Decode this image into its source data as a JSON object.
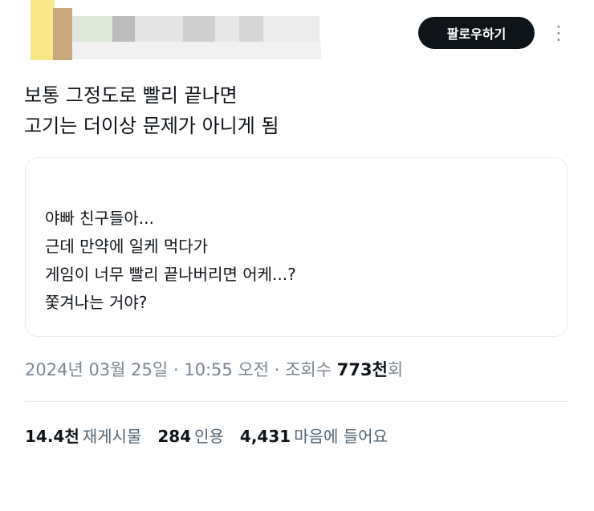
{
  "header": {
    "follow_label": "팔로우하기",
    "more_icon": "⋮",
    "more_icon_name": "more-vertical-icon",
    "censored_palette": [
      "#f7e880",
      "#c9a97a",
      "#dfe8dd",
      "#c7c7c7",
      "#eaeaea",
      "#d9d9d9"
    ]
  },
  "tweet": {
    "lines": [
      "보통 그정도로 빨리 끝나면",
      "고기는 더이상 문제가 아니게 됨"
    ]
  },
  "quote": {
    "lines": [
      "야빠 친구들아...",
      "근데 만약에 일케 먹다가",
      "게임이 너무 빨리 끝나버리면 어케...?",
      "쫓겨나는 거야?"
    ]
  },
  "meta": {
    "date": "2024년 03월 25일",
    "sep1": " · ",
    "time": "10:55 오전",
    "sep2": " · ",
    "views_label": "조회수 ",
    "views_count": "773천",
    "views_suffix": "회"
  },
  "stats": {
    "reposts_count": "14.4천",
    "reposts_label": "재게시물",
    "quotes_count": "284",
    "quotes_label": "인용",
    "likes_count": "4,431",
    "likes_label": "마음에 들어요"
  }
}
